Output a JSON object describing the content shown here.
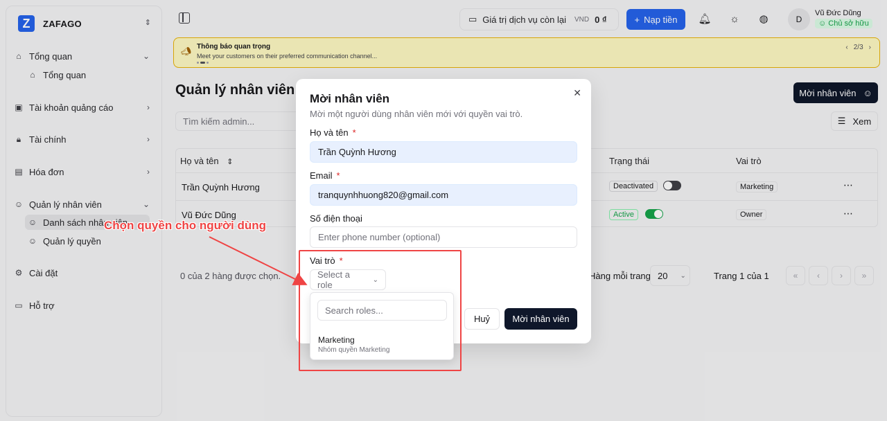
{
  "brand": {
    "name": "ZAFAGO",
    "logo_letter": "Z"
  },
  "sidebar": {
    "items": [
      {
        "label": "Tổng quan",
        "icon": "home-icon"
      },
      {
        "label": "Tổng quan",
        "icon": "home-icon"
      },
      {
        "label": "Tài khoản quảng cáo",
        "icon": "box-icon"
      },
      {
        "label": "Tài chính",
        "icon": "lock-icon"
      },
      {
        "label": "Hóa đơn",
        "icon": "receipt-icon"
      },
      {
        "label": "Quản lý nhân viên",
        "icon": "user-icon"
      },
      {
        "label": "Danh sách nhân viên",
        "icon": "user-icon"
      },
      {
        "label": "Quản lý quyền",
        "icon": "user-icon"
      },
      {
        "label": "Cài đặt",
        "icon": "gear-icon"
      },
      {
        "label": "Hỗ trợ",
        "icon": "chat-icon"
      }
    ]
  },
  "topbar": {
    "balance_label": "Giá trị dịch vụ còn lại",
    "currency": "VND",
    "balance_amount": "0 ₫",
    "topup_label": "Nạp tiền",
    "user_initial": "D",
    "user_name": "Vũ Đức Dũng",
    "user_role": "Chủ sở hữu"
  },
  "notice": {
    "title": "Thông báo quan trọng",
    "body": "Meet your customers on their preferred communication channel...",
    "pager": "2/3"
  },
  "page": {
    "title": "Quản lý nhân viên",
    "invite_label": "Mời nhân viên",
    "search_placeholder": "Tìm kiếm admin...",
    "view_label": "Xem"
  },
  "table": {
    "headers": {
      "name": "Họ và tên",
      "status": "Trạng thái",
      "role": "Vai trò"
    },
    "rows": [
      {
        "name": "Trần Quỳnh Hương",
        "status": "Deactivated",
        "role": "Marketing"
      },
      {
        "name": "Vũ Đức Dũng",
        "status": "Active",
        "role": "Owner"
      }
    ],
    "selected_text": "0 của 2 hàng được chọn.",
    "rows_per_page_label": "Hàng mỗi trang",
    "rows_per_page": "20",
    "page_info": "Trang 1 của 1"
  },
  "modal": {
    "title": "Mời nhân viên",
    "description": "Mời một người dùng nhân viên mới với quyền vai trò.",
    "name_label": "Họ và tên",
    "name_value": "Trần Quỳnh Hương",
    "email_label": "Email",
    "email_value": "tranquynhhuong820@gmail.com",
    "phone_label": "Số điện thoại",
    "phone_placeholder": "Enter phone number (optional)",
    "role_label": "Vai trò",
    "role_placeholder": "Select a role",
    "cancel_label": "Huỷ",
    "submit_label": "Mời nhân viên",
    "required_mark": "*"
  },
  "dropdown": {
    "search_placeholder": "Search roles...",
    "options": [
      {
        "title": "Marketing",
        "subtitle": "Nhóm quyền Marketing"
      }
    ]
  },
  "annotation": {
    "text": "Chọn quyền cho người dùng",
    "color": "#ef4444"
  },
  "colors": {
    "primary": "#2563eb",
    "dark": "#0f172a",
    "success": "#16a34a"
  }
}
